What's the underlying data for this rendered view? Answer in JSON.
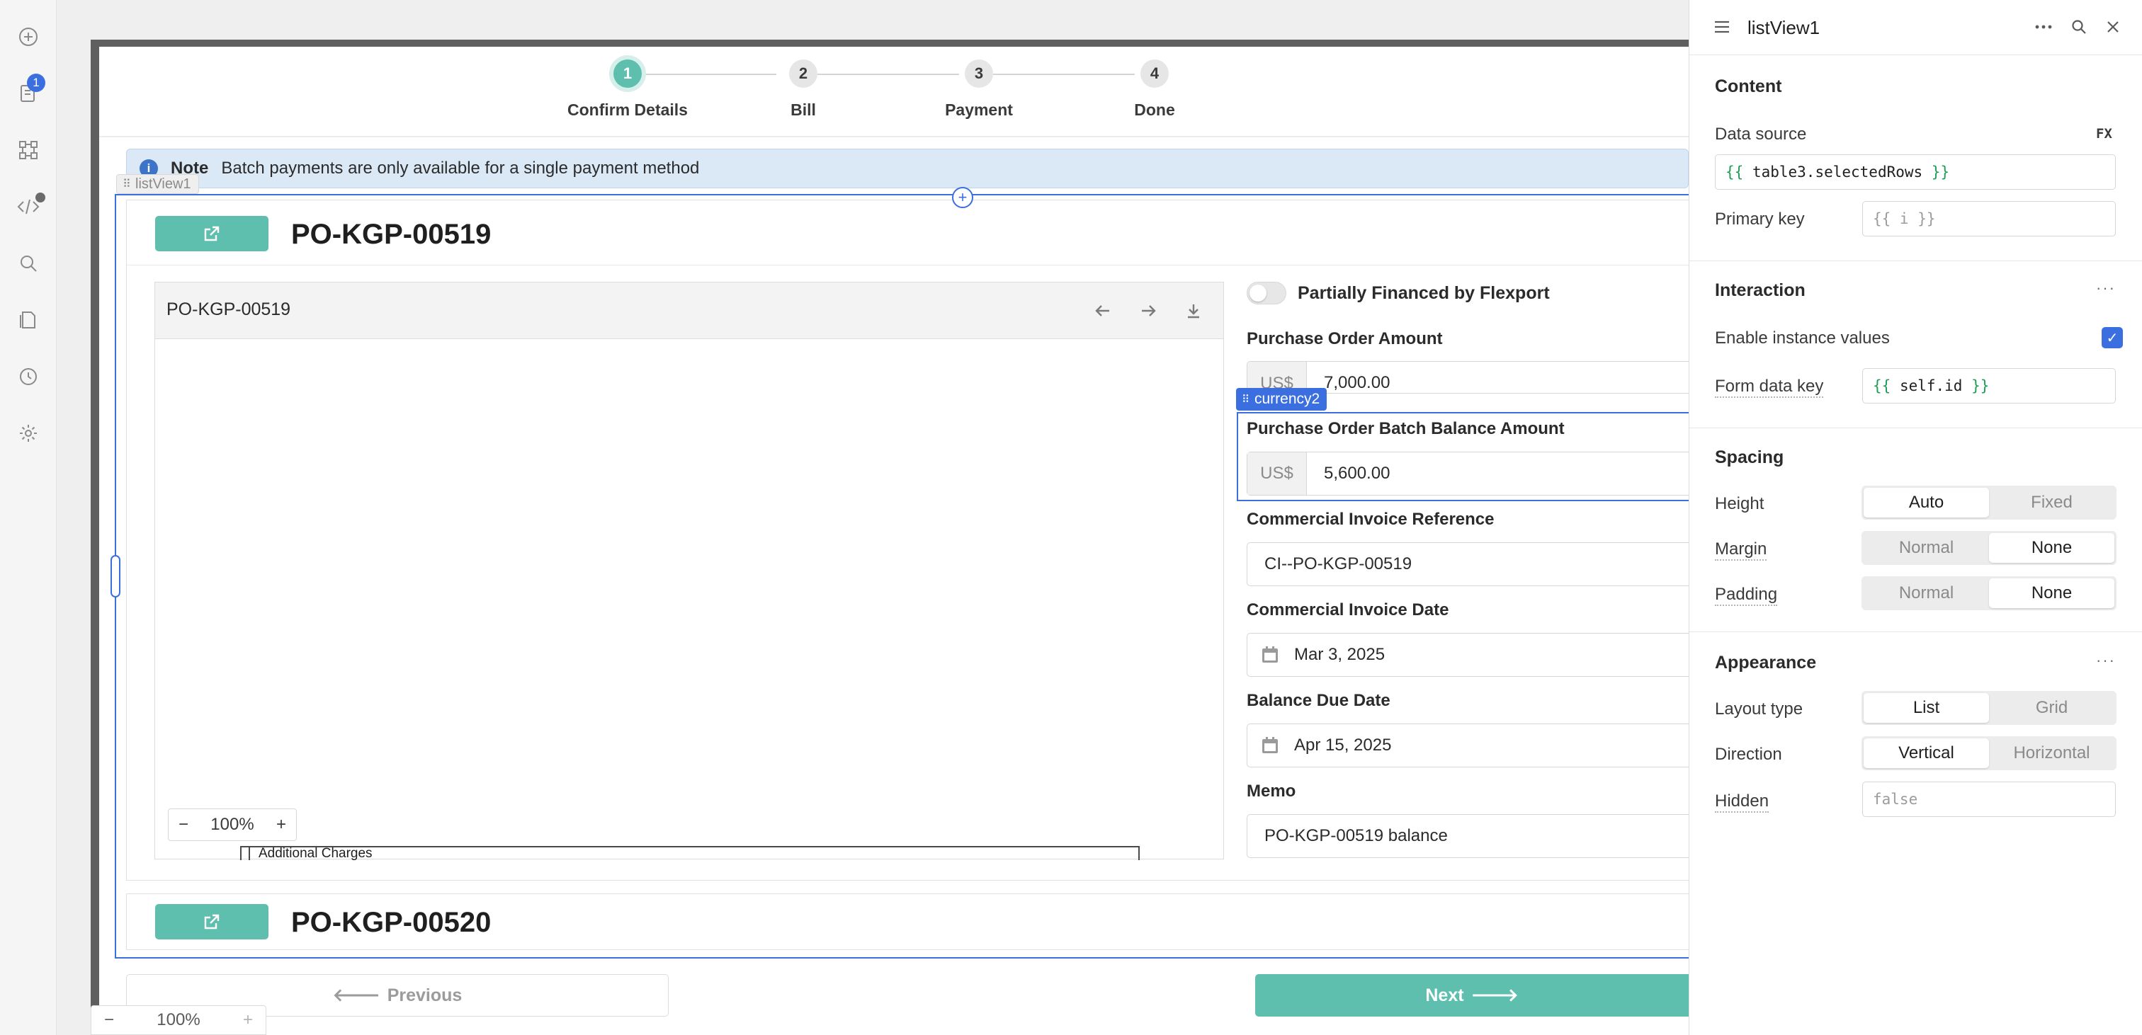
{
  "rail": {
    "notification_count": "1"
  },
  "stepper": {
    "steps": [
      {
        "number": "1",
        "label": "Confirm Details",
        "active": true
      },
      {
        "number": "2",
        "label": "Bill",
        "active": false
      },
      {
        "number": "3",
        "label": "Payment",
        "active": false
      },
      {
        "number": "4",
        "label": "Done",
        "active": false
      }
    ]
  },
  "note": {
    "title": "Note",
    "text": "Batch payments are only available for a single payment method"
  },
  "list_view": {
    "tag": "listView1"
  },
  "cards": [
    {
      "title": "PO-KGP-00519",
      "pdf": {
        "file_name": "PO-KGP-00519",
        "zoom": "100%",
        "doc_text": "Additional Charges"
      },
      "form": {
        "toggle_label": "Partially Financed by Flexport",
        "po_amount_label": "Purchase Order Amount",
        "po_amount_prefix": "US$",
        "po_amount_value": "7,000.00",
        "component_tag": "currency2",
        "batch_balance_label": "Purchase Order Batch Balance Amount",
        "batch_balance_prefix": "US$",
        "batch_balance_value": "5,600.00",
        "ci_ref_label": "Commercial Invoice Reference",
        "ci_ref_value": "CI--PO-KGP-00519",
        "ci_date_label": "Commercial Invoice Date",
        "ci_date_value": "Mar 3, 2025",
        "due_date_label": "Balance Due Date",
        "due_date_value": "Apr 15, 2025",
        "memo_label": "Memo",
        "memo_value": "PO-KGP-00519 balance"
      }
    },
    {
      "title": "PO-KGP-00520"
    }
  ],
  "footer": {
    "previous_label": "Previous",
    "next_label": "Next",
    "canvas_zoom": "100%"
  },
  "panel": {
    "title": "listView1",
    "content": {
      "title": "Content",
      "data_source_label": "Data source",
      "fx_label": "FX",
      "data_source_value": "table3.selectedRows",
      "primary_key_label": "Primary key",
      "primary_key_placeholder": "{{ i }}"
    },
    "interaction": {
      "title": "Interaction",
      "enable_instance_label": "Enable instance values",
      "enable_instance_checked": true,
      "form_key_label": "Form data key",
      "form_key_value": "self.id"
    },
    "spacing": {
      "title": "Spacing",
      "height_label": "Height",
      "height_options": [
        "Auto",
        "Fixed"
      ],
      "height_selected": "Auto",
      "margin_label": "Margin",
      "margin_options": [
        "Normal",
        "None"
      ],
      "margin_selected": "None",
      "padding_label": "Padding",
      "padding_options": [
        "Normal",
        "None"
      ],
      "padding_selected": "None"
    },
    "appearance": {
      "title": "Appearance",
      "layout_label": "Layout type",
      "layout_options": [
        "List",
        "Grid"
      ],
      "layout_selected": "List",
      "direction_label": "Direction",
      "direction_options": [
        "Vertical",
        "Horizontal"
      ],
      "direction_selected": "Vertical",
      "hidden_label": "Hidden",
      "hidden_placeholder": "false"
    }
  },
  "colors": {
    "accent": "#5ebfae",
    "selection": "#3b6fe0",
    "note_bg": "#dbe9f7"
  }
}
